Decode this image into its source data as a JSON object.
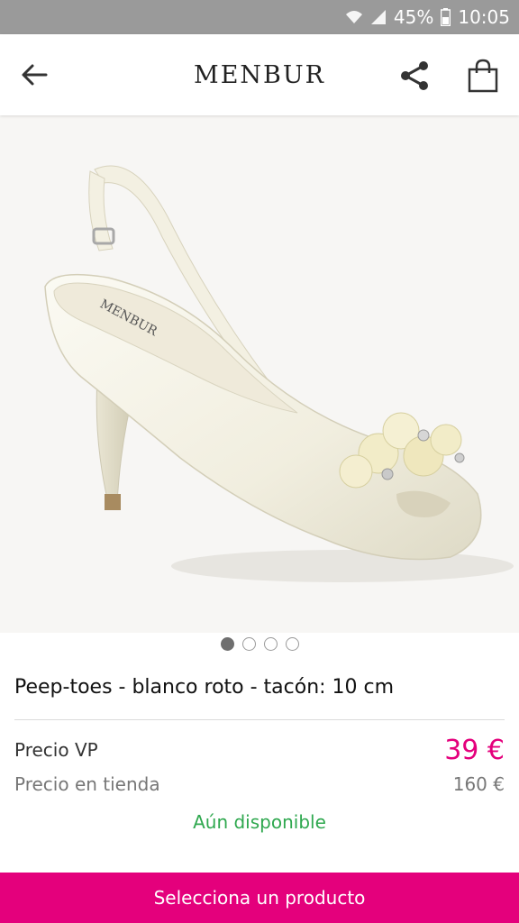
{
  "status_bar": {
    "battery": "45%",
    "time": "10:05",
    "icons": [
      "wifi-icon",
      "signal-icon",
      "battery-icon"
    ]
  },
  "app_bar": {
    "brand": "MENBUR",
    "back_icon": "arrow-left-icon",
    "share_icon": "share-icon",
    "cart_icon": "shopping-bag-icon"
  },
  "gallery": {
    "total_images": 4,
    "active_index": 0,
    "image_subject": "bridal peep-toe slingback shoe"
  },
  "product": {
    "title": "Peep-toes - blanco roto - tacón: 10 cm",
    "vp_label": "Precio VP",
    "vp_price": "39 €",
    "store_label": "Precio en tienda",
    "store_price": "160 €",
    "availability": "Aún disponible"
  },
  "cta": {
    "label": "Selecciona un producto"
  },
  "colors": {
    "accent": "#e4007c",
    "available": "#2fa84f",
    "status_bar": "#9a9a9a"
  }
}
